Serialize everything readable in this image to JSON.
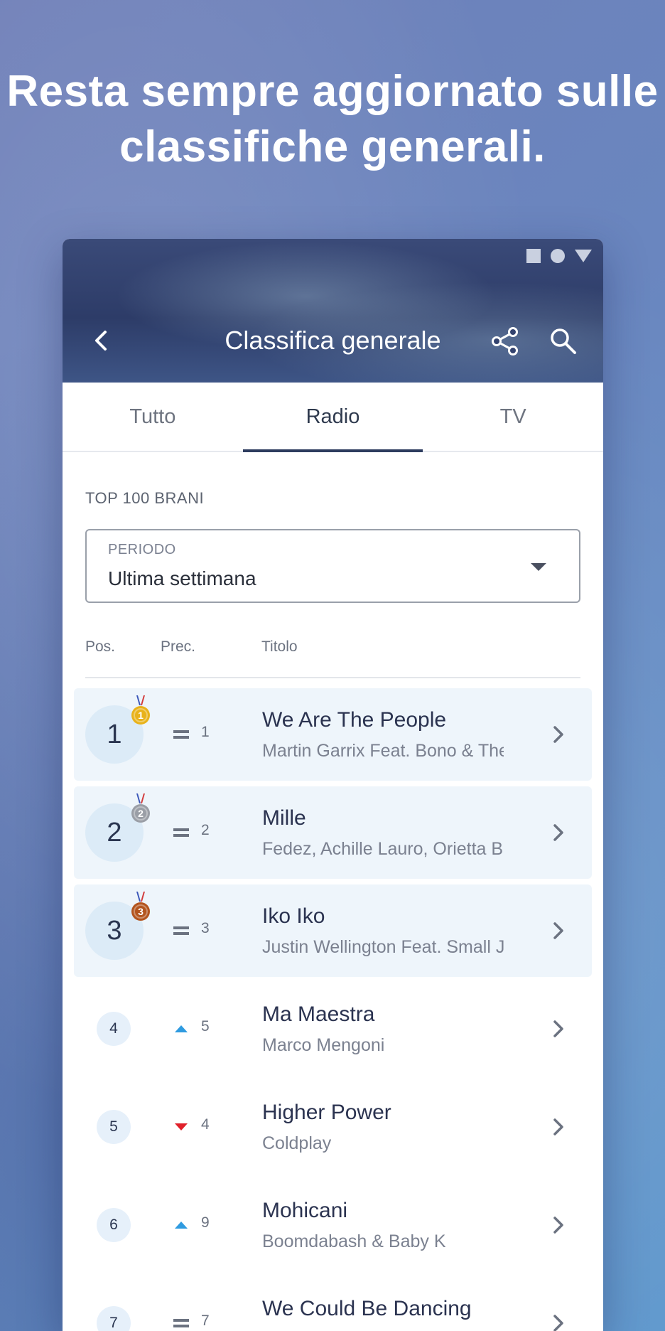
{
  "headline": {
    "line1": "Resta sempre aggiornato sulle",
    "line2": "classifiche generali."
  },
  "appbar": {
    "title": "Classifica generale",
    "icons": [
      "back-arrow-icon",
      "share-icon",
      "search-icon"
    ]
  },
  "tabs": [
    {
      "label": "Tutto",
      "active": false
    },
    {
      "label": "Radio",
      "active": true
    },
    {
      "label": "TV",
      "active": false
    }
  ],
  "section": {
    "label": "TOP 100 BRANI"
  },
  "period": {
    "label": "PERIODO",
    "value": "Ultima settimana"
  },
  "columns": {
    "pos": "Pos.",
    "prec": "Prec.",
    "titolo": "Titolo"
  },
  "rows": [
    {
      "pos": "1",
      "prev": "1",
      "trend": "same",
      "title": "We Are The People",
      "artist": "Martin Garrix Feat. Bono & The ...",
      "medal": "gold"
    },
    {
      "pos": "2",
      "prev": "2",
      "trend": "same",
      "title": "Mille",
      "artist": "Fedez, Achille Lauro, Orietta Be...",
      "medal": "silver"
    },
    {
      "pos": "3",
      "prev": "3",
      "trend": "same",
      "title": "Iko Iko",
      "artist": "Justin Wellington Feat. Small J...",
      "medal": "bronze"
    },
    {
      "pos": "4",
      "prev": "5",
      "trend": "up",
      "title": "Ma Maestra",
      "artist": "Marco Mengoni"
    },
    {
      "pos": "5",
      "prev": "4",
      "trend": "down",
      "title": "Higher Power",
      "artist": "Coldplay"
    },
    {
      "pos": "6",
      "prev": "9",
      "trend": "up",
      "title": "Mohicani",
      "artist": "Boomdabash & Baby K"
    },
    {
      "pos": "7",
      "prev": "7",
      "trend": "same",
      "title": "We Could Be Dancing",
      "artist": ""
    }
  ],
  "medal_labels": {
    "gold": "1",
    "silver": "2",
    "bronze": "3"
  },
  "colors": {
    "up": "#2f9be0",
    "down": "#e0202a",
    "same": "#6b7280",
    "gold": "#e8b21a",
    "silver": "#9a9ea6",
    "bronze": "#b3541e",
    "accent": "#2d3c5e"
  }
}
